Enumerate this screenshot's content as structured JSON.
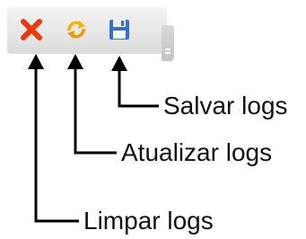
{
  "toolbar": {
    "buttons": [
      {
        "id": "clear",
        "icon": "red-x-icon",
        "color": "#e8380d"
      },
      {
        "id": "refresh",
        "icon": "refresh-arrows-icon",
        "color": "#f0b400"
      },
      {
        "id": "save",
        "icon": "floppy-disk-icon",
        "color": "#3a6fc4"
      }
    ]
  },
  "callouts": {
    "save": "Salvar logs",
    "refresh": "Atualizar logs",
    "clear": "Limpar logs"
  }
}
